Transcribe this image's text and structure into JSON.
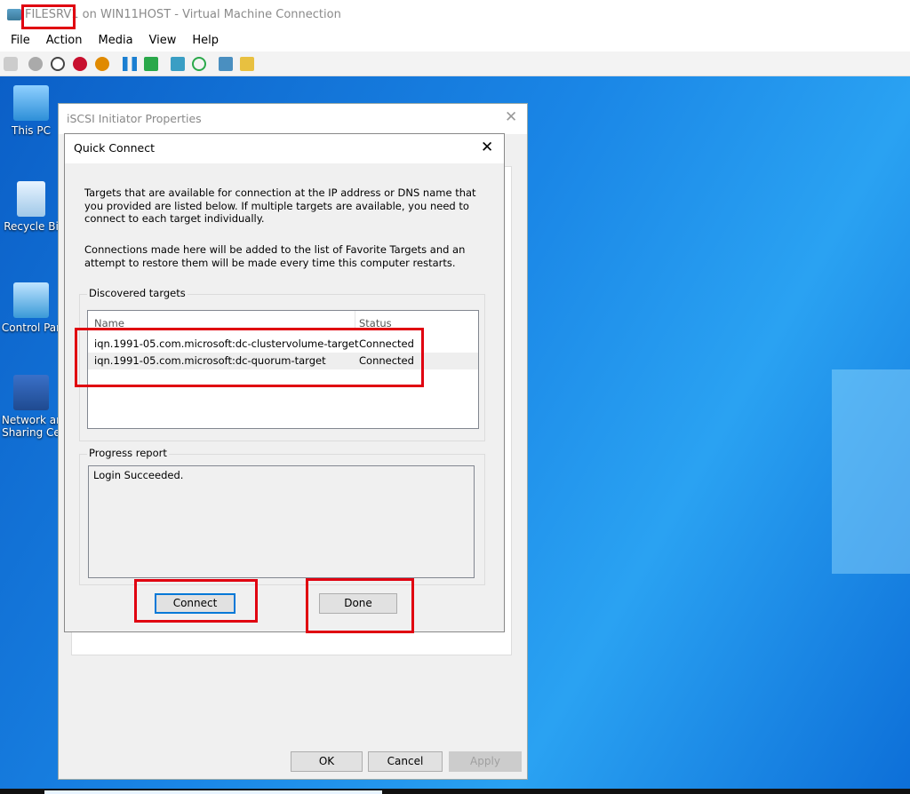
{
  "window": {
    "title_host": "FILESRV1",
    "title_rest": " on WIN11HOST - Virtual Machine Connection"
  },
  "menu": [
    "File",
    "Action",
    "Media",
    "View",
    "Help"
  ],
  "toolbar_icons": [
    "ctrl-alt-del-icon",
    "start-icon",
    "turn-off-icon",
    "shutdown-icon",
    "save-icon",
    "pause-icon",
    "reset-icon",
    "checkpoint-icon",
    "revert-icon",
    "enhanced-session-icon",
    "share-icon"
  ],
  "desktop_icons": [
    {
      "label": "This PC"
    },
    {
      "label": "Recycle Bi"
    },
    {
      "label": "Control Par"
    },
    {
      "label": "Network ar",
      "label2": "Sharing Ce"
    }
  ],
  "iscsi": {
    "title": "iSCSI Initiator Properties",
    "ok": "OK",
    "cancel": "Cancel",
    "apply": "Apply"
  },
  "quick_connect": {
    "title": "Quick Connect",
    "desc1": "Targets that are available for connection at the IP address or DNS name that you provided are listed below.  If multiple targets are available, you need to connect to each target individually.",
    "desc2": "Connections made here will be added to the list of Favorite Targets and an attempt to restore them will be made every time this computer restarts.",
    "discovered_label": "Discovered targets",
    "columns": [
      "Name",
      "Status"
    ],
    "targets": [
      {
        "name": "iqn.1991-05.com.microsoft:dc-clustervolume-target",
        "status": "Connected"
      },
      {
        "name": "iqn.1991-05.com.microsoft:dc-quorum-target",
        "status": "Connected"
      }
    ],
    "progress_label": "Progress report",
    "progress_text": "Login Succeeded.",
    "connect": "Connect",
    "done": "Done"
  },
  "colors": {
    "annotation": "#e00010",
    "desktop": "#1a86e6"
  }
}
